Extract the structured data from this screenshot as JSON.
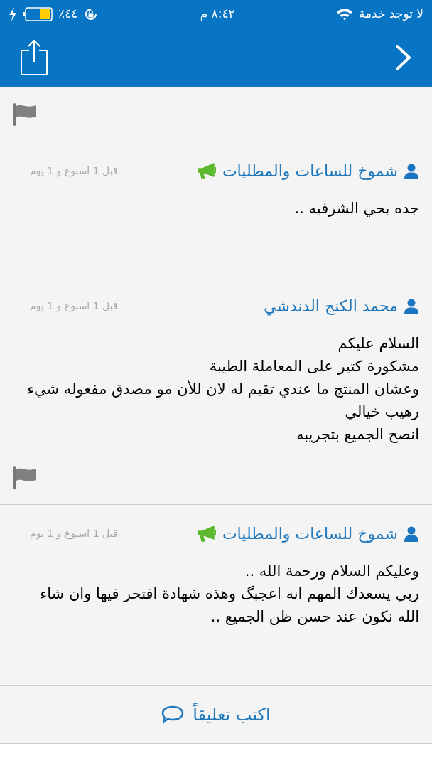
{
  "status_bar": {
    "carrier": "لا توجد خدمة",
    "time": "٨:٤٢ م",
    "battery": "٤٤٪",
    "charging": true
  },
  "comments": [
    {
      "author": "شموخ للساعات والمطليات",
      "seller": true,
      "time": "قبل 1 اسبوع و 1 يوم",
      "lines": [
        "جده بحي الشرفيه .."
      ],
      "flag": false
    },
    {
      "author": "محمد الكنج الدندشي",
      "seller": false,
      "time": "قبل 1 اسبوع و 1 يوم",
      "lines": [
        "السلام عليكم",
        "مشكورة كتير على المعاملة الطيبة",
        "وعشان المنتج ما عندي تقيم له لان للأن مو مصدق مفعوله شيء",
        "رهيب خيالي",
        "انصح الجميع بتجريبه"
      ],
      "flag": true
    },
    {
      "author": "شموخ للساعات والمطليات",
      "seller": true,
      "time": "قبل 1 اسبوع و 1 يوم",
      "lines": [
        "وعليكم السلام ورحمة الله ..",
        "ربي يسعدك المهم انه اعجبگ وهذه شهادة افتحر فيها وان شاء",
        "الله نكون عند حسن ظن الجميع .."
      ],
      "flag": false
    }
  ],
  "write_comment": "اكتب تعليقاً"
}
